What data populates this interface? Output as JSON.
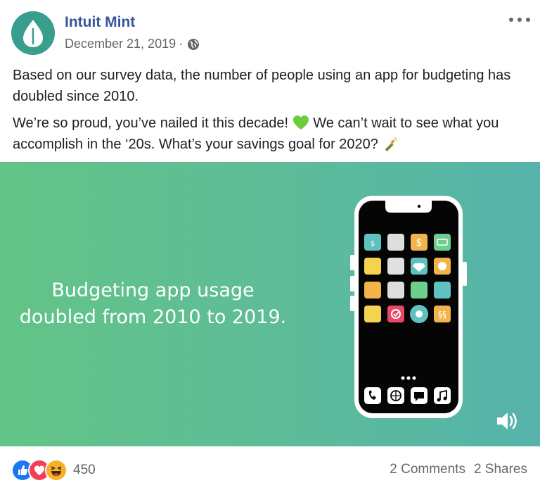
{
  "post": {
    "page_name": "Intuit Mint",
    "date": "December 21, 2019",
    "date_separator": "·",
    "paragraph_1": "Based on our survey data, the number of people using an app for budgeting has doubled since 2010.",
    "paragraph_2a": "We’re so proud, you’ve nailed it this decade!",
    "paragraph_2b": "We can’t wait to see what you accomplish in the ‘20s. What’s your savings goal for 2020?",
    "media": {
      "caption_line_1": "Budgeting app usage",
      "caption_line_2": "doubled from 2010 to 2019.",
      "gradient_start": "#63c487",
      "gradient_end": "#55b3ab"
    },
    "footer": {
      "reaction_count": "450",
      "comments": "2 Comments",
      "shares": "2 Shares",
      "reactions": [
        "like-icon",
        "love-icon",
        "haha-icon"
      ]
    }
  },
  "colors": {
    "brand": "#36559a",
    "muted": "#65676b",
    "avatar_bg": "#3a9e8e"
  }
}
